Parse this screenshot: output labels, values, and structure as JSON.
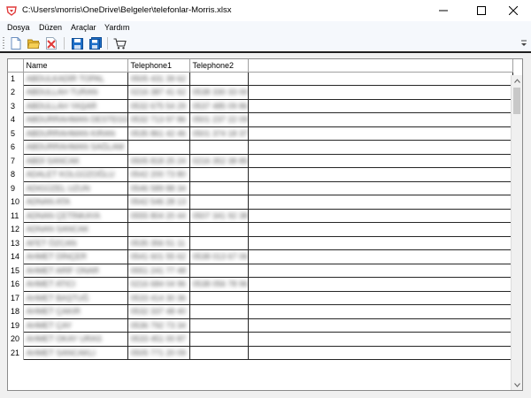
{
  "window": {
    "title": "C:\\Users\\morris\\OneDrive\\Belgeler\\telefonlar-Morris.xlsx"
  },
  "menu": [
    "Dosya",
    "Düzen",
    "Araçlar",
    "Yardım"
  ],
  "toolbar": {
    "buttons": [
      "new-file-icon",
      "open-folder-icon",
      "delete-icon",
      "save-icon",
      "save-all-icon",
      "cart-icon"
    ]
  },
  "colors": {
    "accent": "#e03a3a",
    "folder": "#e8b830",
    "save": "#1e6fc8"
  },
  "grid": {
    "columns": [
      "Name",
      "Telephone1",
      "Telephone2"
    ],
    "rows": [
      {
        "n": "1",
        "name": "ABDULKADİR TOPAL",
        "t1": "0505 431 39 62",
        "t2": ""
      },
      {
        "n": "2",
        "name": "ABDULLAH TURAN",
        "t1": "0216 387 41 62",
        "t2": "0538 330 33 00"
      },
      {
        "n": "3",
        "name": "ABDULLAH YAŞAR",
        "t1": "0532 675 54 29",
        "t2": "0537 485 09 86"
      },
      {
        "n": "4",
        "name": "ABDURRAHMAN DESTEGÜL",
        "t1": "0532 713 97 86",
        "t2": "0501 237 22 09"
      },
      {
        "n": "5",
        "name": "ABDURRAHMAN KIRAN",
        "t1": "0535 861 42 46",
        "t2": "0501 374 18 37"
      },
      {
        "n": "6",
        "name": "ABDURRAHMAN SAĞLAM",
        "t1": "",
        "t2": ""
      },
      {
        "n": "7",
        "name": "ABDİ SANCAK",
        "t1": "0505 818 25 24",
        "t2": "0216 352 38 85"
      },
      {
        "n": "8",
        "name": "ADALET KOLGÜZOĞLU",
        "t1": "0542 200 73 80",
        "t2": ""
      },
      {
        "n": "9",
        "name": "ADIGÜZEL UZUN",
        "t1": "0546 589 88 34",
        "t2": ""
      },
      {
        "n": "10",
        "name": "ADNAN ATA",
        "t1": "0542 546 28 13",
        "t2": ""
      },
      {
        "n": "11",
        "name": "ADNAN ÇETİNKAYA",
        "t1": "0555 804 20 44",
        "t2": "0507 341 92 38"
      },
      {
        "n": "12",
        "name": "ADNAN SANCAK",
        "t1": "",
        "t2": ""
      },
      {
        "n": "13",
        "name": "AFET ÖZCAN",
        "t1": "0535 356 51 11",
        "t2": ""
      },
      {
        "n": "14",
        "name": "AHMET DİNÇER",
        "t1": "0541 601 55 62",
        "t2": "0538 013 67 06"
      },
      {
        "n": "15",
        "name": "AHMET ARİF ONAR",
        "t1": "0551 241 77 48",
        "t2": ""
      },
      {
        "n": "16",
        "name": "AHMET ATICI",
        "t1": "0216 684 04 96",
        "t2": "0538 056 78 96"
      },
      {
        "n": "17",
        "name": "AHMET BAŞTUĞ",
        "t1": "0533 414 30 36",
        "t2": ""
      },
      {
        "n": "18",
        "name": "AHMET ÇAKIR",
        "t1": "0532 337 48 40",
        "t2": ""
      },
      {
        "n": "19",
        "name": "AHMET ÇAY",
        "t1": "0536 792 73 34",
        "t2": ""
      },
      {
        "n": "20",
        "name": "AHMET OKAY URAS",
        "t1": "0533 451 00 87",
        "t2": ""
      },
      {
        "n": "21",
        "name": "AHMET SANCAKLI",
        "t1": "0505 771 20 09",
        "t2": ""
      }
    ]
  }
}
